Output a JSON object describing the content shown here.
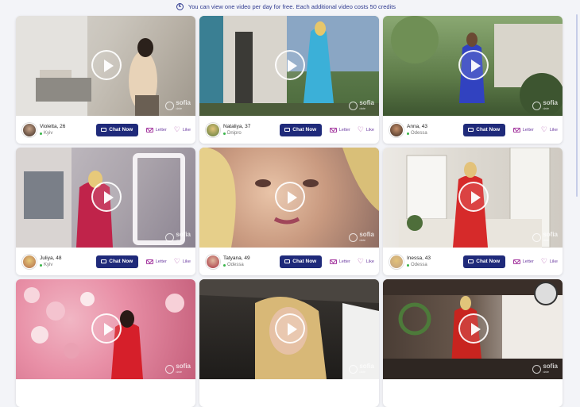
{
  "notice": {
    "text": "You can view one video per day for free. Each additional video costs 50 credits",
    "icon": "info-icon"
  },
  "labels": {
    "chat": "Chat Now",
    "letter": "Letter",
    "like": "Like",
    "watermark": "sofia",
    "watermark_sub": "date"
  },
  "colors": {
    "accent": "#1f2a7a",
    "action": "#a53aa0",
    "online": "#3ab54a"
  },
  "cards": [
    {
      "name": "Violetta, 26",
      "city": "Kyiv"
    },
    {
      "name": "Nataliya, 37",
      "city": "Dnipro"
    },
    {
      "name": "Anna, 43",
      "city": "Odessa"
    },
    {
      "name": "Juliya, 48",
      "city": "Kyiv"
    },
    {
      "name": "Tatyana, 49",
      "city": "Odessa"
    },
    {
      "name": "Inessa, 43",
      "city": "Odessa"
    },
    {
      "name": "",
      "city": ""
    },
    {
      "name": "",
      "city": ""
    },
    {
      "name": "",
      "city": ""
    }
  ]
}
